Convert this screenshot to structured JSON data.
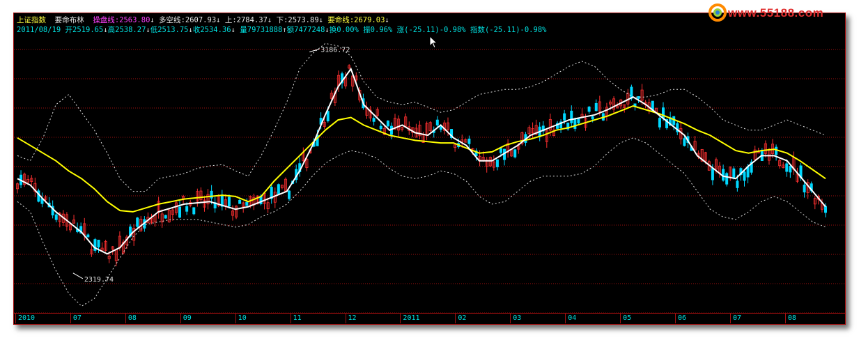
{
  "header": {
    "index_name": "上证指数",
    "indicator_name": "要命布林",
    "items": [
      {
        "label": "操盘线",
        "value": "2563.80",
        "dir": "↓"
      },
      {
        "label": "多空线",
        "value": "2607.93",
        "dir": "↓"
      },
      {
        "label": "上",
        "value": "2784.37",
        "dir": "↓"
      },
      {
        "label": "下",
        "value": "2573.89",
        "dir": "↓"
      },
      {
        "label": "要命线",
        "value": "2679.03",
        "dir": "↓"
      }
    ]
  },
  "quote": {
    "date": "2011/08/19",
    "open": "开2519.65",
    "open_dir": "↓",
    "high": "高2538.27",
    "high_dir": "↓",
    "low": "低2513.75",
    "low_dir": "↓",
    "close": "收2534.36",
    "close_dir": "↓",
    "volume": "量79731888",
    "volume_dir": "↑",
    "amount": "额7477248",
    "amount_dir": "↓",
    "turnover": "换0.00%",
    "amplitude": "振0.96%",
    "change": "涨(-25.11)-0.98%",
    "index_change": "指数(-25.11)-0.98%"
  },
  "logo": {
    "text": "www.55188.com"
  },
  "colors": {
    "background": "#000000",
    "up_candle": "#ff3030",
    "down_candle": "#00d8ff",
    "ma_white": "#ffffff",
    "ma_yellow": "#ffff00",
    "band": "#e0e0e0",
    "grid": "#a01010"
  },
  "chart_data": {
    "type": "candlestick",
    "x_months": [
      "2010",
      "07",
      "08",
      "09",
      "10",
      "11",
      "12",
      "2011",
      "02",
      "03",
      "04",
      "05",
      "06",
      "07",
      "08"
    ],
    "ylim": [
      2180,
      3240
    ],
    "annotations": [
      {
        "label": "3186.72",
        "kind": "high",
        "x_month_index": 5.35
      },
      {
        "label": "2319.74",
        "kind": "low",
        "x_month_index": 1.05
      }
    ],
    "series": [
      {
        "name": "close_white",
        "values": [
          2690,
          2665,
          2610,
          2560,
          2520,
          2480,
          2420,
          2395,
          2420,
          2480,
          2520,
          2560,
          2575,
          2590,
          2595,
          2600,
          2585,
          2570,
          2580,
          2600,
          2620,
          2640,
          2720,
          2820,
          2940,
          3050,
          3120,
          2980,
          2930,
          2880,
          2900,
          2870,
          2860,
          2900,
          2850,
          2820,
          2760,
          2760,
          2790,
          2820,
          2860,
          2880,
          2900,
          2920,
          2930,
          2940,
          2960,
          2985,
          3010,
          2980,
          2940,
          2900,
          2860,
          2780,
          2740,
          2700,
          2690,
          2740,
          2780,
          2780,
          2760,
          2700,
          2640,
          2580
        ]
      },
      {
        "name": "ma_yellow",
        "values": [
          2850,
          2820,
          2790,
          2760,
          2720,
          2690,
          2650,
          2600,
          2565,
          2560,
          2575,
          2590,
          2600,
          2610,
          2615,
          2620,
          2625,
          2620,
          2600,
          2620,
          2680,
          2730,
          2780,
          2830,
          2880,
          2920,
          2930,
          2900,
          2880,
          2860,
          2850,
          2840,
          2835,
          2830,
          2830,
          2810,
          2790,
          2795,
          2820,
          2835,
          2845,
          2860,
          2880,
          2890,
          2905,
          2920,
          2935,
          2955,
          2975,
          2960,
          2945,
          2925,
          2905,
          2880,
          2860,
          2830,
          2800,
          2790,
          2800,
          2805,
          2790,
          2760,
          2725,
          2690
        ]
      },
      {
        "name": "upper_band",
        "values": [
          2780,
          2760,
          2850,
          2980,
          3020,
          2950,
          2880,
          2790,
          2690,
          2640,
          2640,
          2690,
          2700,
          2710,
          2730,
          2740,
          2745,
          2720,
          2700,
          2780,
          2880,
          2990,
          3120,
          3180,
          3220,
          3210,
          3170,
          3070,
          3010,
          2990,
          2980,
          2990,
          2970,
          2950,
          2960,
          2990,
          3020,
          3030,
          3040,
          3040,
          3050,
          3070,
          3100,
          3130,
          3150,
          3130,
          3080,
          3040,
          3010,
          3010,
          3020,
          3040,
          3040,
          3010,
          2970,
          2920,
          2900,
          2880,
          2880,
          2900,
          2920,
          2900,
          2880,
          2860
        ]
      },
      {
        "name": "lower_band",
        "values": [
          2600,
          2560,
          2440,
          2330,
          2240,
          2190,
          2220,
          2300,
          2380,
          2460,
          2510,
          2520,
          2530,
          2530,
          2530,
          2520,
          2510,
          2500,
          2510,
          2540,
          2560,
          2590,
          2640,
          2700,
          2750,
          2780,
          2800,
          2790,
          2770,
          2730,
          2700,
          2690,
          2700,
          2720,
          2710,
          2680,
          2620,
          2590,
          2600,
          2640,
          2680,
          2700,
          2700,
          2700,
          2710,
          2740,
          2790,
          2830,
          2850,
          2830,
          2790,
          2750,
          2710,
          2640,
          2570,
          2540,
          2530,
          2560,
          2600,
          2620,
          2600,
          2560,
          2520,
          2500
        ]
      }
    ]
  }
}
